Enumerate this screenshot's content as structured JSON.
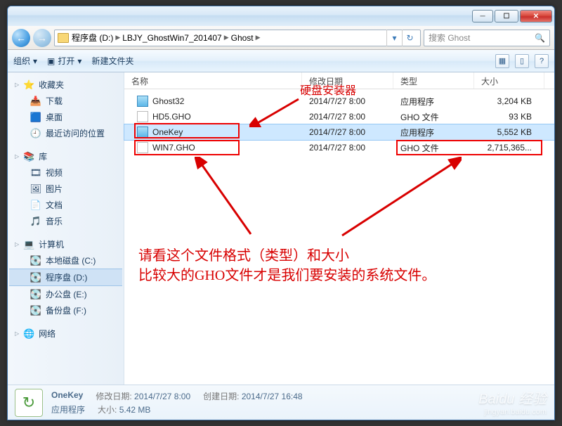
{
  "breadcrumb": {
    "p1": "程序盘 (D:)",
    "p2": "LBJY_GhostWin7_201407",
    "p3": "Ghost"
  },
  "search": {
    "placeholder": "搜索 Ghost"
  },
  "toolbar": {
    "organize": "组织",
    "open": "打开",
    "newfolder": "新建文件夹"
  },
  "sidebar": {
    "fav": "收藏夹",
    "downloads": "下载",
    "desktop": "桌面",
    "recent": "最近访问的位置",
    "lib": "库",
    "videos": "视频",
    "pictures": "图片",
    "documents": "文档",
    "music": "音乐",
    "computer": "计算机",
    "driveC": "本地磁盘 (C:)",
    "driveD": "程序盘 (D:)",
    "driveE": "办公盘 (E:)",
    "driveF": "备份盘 (F:)",
    "network": "网络"
  },
  "columns": {
    "name": "名称",
    "date": "修改日期",
    "type": "类型",
    "size": "大小"
  },
  "files": [
    {
      "name": "Ghost32",
      "date": "2014/7/27 8:00",
      "type": "应用程序",
      "size": "3,204 KB"
    },
    {
      "name": "HD5.GHO",
      "date": "2014/7/27 8:00",
      "type": "GHO 文件",
      "size": "93 KB"
    },
    {
      "name": "OneKey",
      "date": "2014/7/27 8:00",
      "type": "应用程序",
      "size": "5,552 KB"
    },
    {
      "name": "WIN7.GHO",
      "date": "2014/7/27 8:00",
      "type": "GHO 文件",
      "size": "2,715,365..."
    }
  ],
  "annotations": {
    "top": "硬盘安装器",
    "body1": "请看这个文件格式（类型）和大小",
    "body2": "比较大的GHO文件才是我们要安装的系统文件。"
  },
  "status": {
    "filename": "OneKey",
    "modlabel": "修改日期:",
    "moddate": "2014/7/27 8:00",
    "typelabel": "",
    "type": "应用程序",
    "createlabel": "创建日期:",
    "createdate": "2014/7/27 16:48",
    "sizelabel": "大小:",
    "size": "5.42 MB"
  },
  "watermark": {
    "brand": "Baidu 经验",
    "url": "jingyan.baidu.com"
  }
}
